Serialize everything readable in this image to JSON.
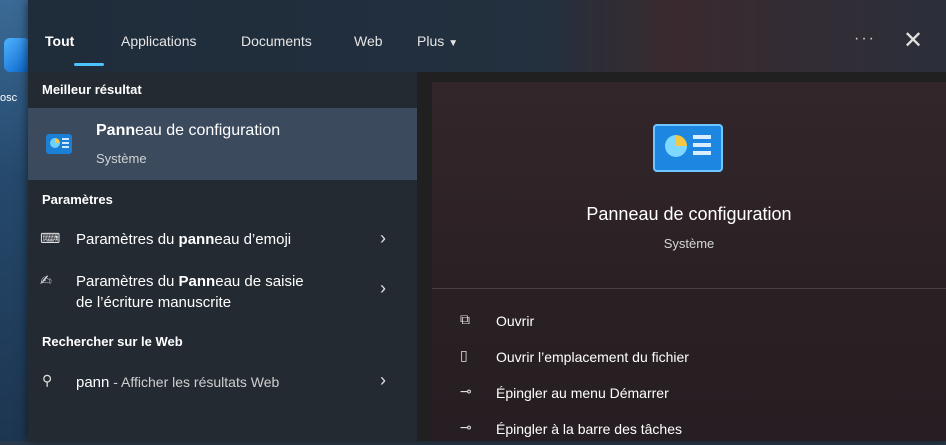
{
  "desktop": {
    "label": "osc"
  },
  "tabs": [
    {
      "label": "Tout"
    },
    {
      "label": "Applications"
    },
    {
      "label": "Documents"
    },
    {
      "label": "Web"
    },
    {
      "label": "Plus"
    }
  ],
  "header": {
    "dots": "···",
    "close": "✕"
  },
  "sections": {
    "best": "Meilleur résultat",
    "settings": "Paramètres",
    "web": "Rechercher sur le Web"
  },
  "best_result": {
    "name_bold": "Pann",
    "name_rest": "eau de configuration",
    "subtitle": "Système"
  },
  "settings_items": [
    {
      "pre": "Paramètres du ",
      "bold": "pann",
      "post": "eau d’emoji",
      "line2": ""
    },
    {
      "pre": "Paramètres du ",
      "bold": "Pann",
      "post": "eau de saisie",
      "line2": "de l’écriture manuscrite"
    }
  ],
  "web_item": {
    "query": "pann",
    "rest": " - Afficher les résultats Web"
  },
  "preview": {
    "name": "Panneau de configuration",
    "subtitle": "Système",
    "actions": [
      {
        "label": "Ouvrir",
        "icon": "open-icon"
      },
      {
        "label": "Ouvrir l’emplacement du fichier",
        "icon": "folder-location-icon"
      },
      {
        "label": "Épingler au menu Démarrer",
        "icon": "pin-icon"
      },
      {
        "label": "Épingler à la barre des tâches",
        "icon": "pin-icon"
      }
    ]
  },
  "colors": {
    "accent": "#4cc2ff",
    "selected": "#3b4a5c"
  }
}
